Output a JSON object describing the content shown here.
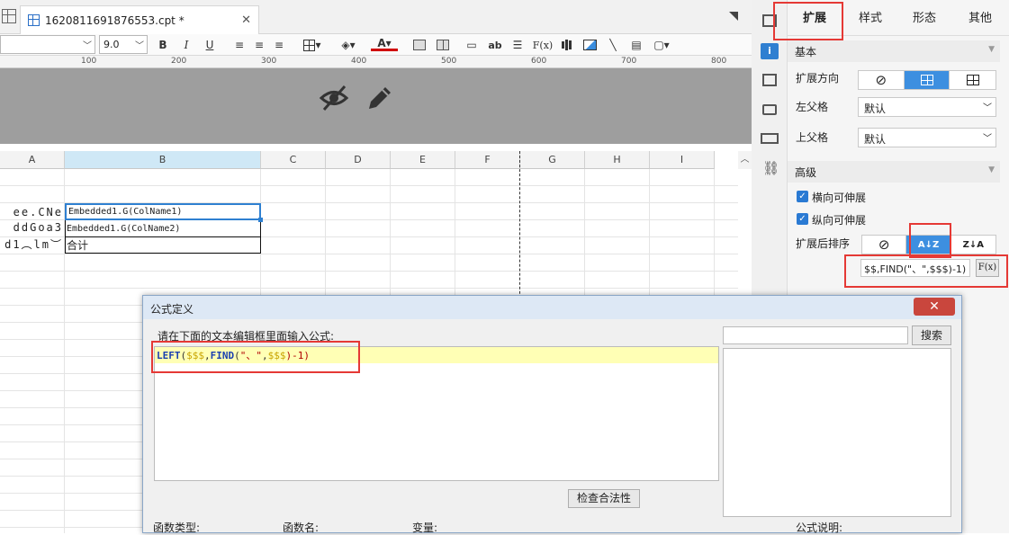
{
  "document": {
    "tab_title": "1620811691876553.cpt *",
    "close_glyph": "✕",
    "menu_glyph": "▾"
  },
  "toolbar": {
    "font_size": "9.0",
    "bold": "B",
    "italic": "I",
    "underline": "U",
    "formula_button": "F(x)",
    "text_button": "ab"
  },
  "ruler": {
    "ticks": [
      "100",
      "200",
      "300",
      "400",
      "500",
      "600",
      "700",
      "800"
    ]
  },
  "sheet": {
    "columns": [
      "A",
      "B",
      "C",
      "D",
      "E",
      "F",
      "G",
      "H",
      "I"
    ],
    "col_a_rows": [
      "ee.CNe",
      "ddGoa3",
      "d1︵lm︶"
    ],
    "cell_b1": "Embedded1.G(ColName1)",
    "cell_b2": "Embedded1.G(ColName2)",
    "cell_b3": "合计"
  },
  "panel": {
    "tabs": [
      "扩展",
      "样式",
      "形态",
      "其他"
    ],
    "section_basic": "基本",
    "expand_direction": "扩展方向",
    "left_parent": "左父格",
    "left_parent_value": "默认",
    "top_parent": "上父格",
    "top_parent_value": "默认",
    "section_advanced": "高级",
    "horizontal_extend": "横向可伸展",
    "vertical_extend": "纵向可伸展",
    "sort_after_expand": "扩展后排序",
    "sort_formula": "$$,FIND(\"、\",$$$)-1)",
    "fx_label": "F(x)"
  },
  "dialog": {
    "title": "公式定义",
    "instruction": "请在下面的文本编辑框里面输入公式:",
    "formula": {
      "fn1": "LEFT",
      "open": "(",
      "arg1": "$$$",
      "comma1": ",",
      "fn2": "FIND",
      "open2": "(",
      "str": "\"、\"",
      "comma2": ",",
      "arg2": "$$$",
      "tail": ")-1)"
    },
    "search_button": "搜索",
    "check_button": "检查合法性",
    "function_type": "函数类型:",
    "function_name": "函数名:",
    "variable": "变量:",
    "formula_desc": "公式说明:"
  }
}
